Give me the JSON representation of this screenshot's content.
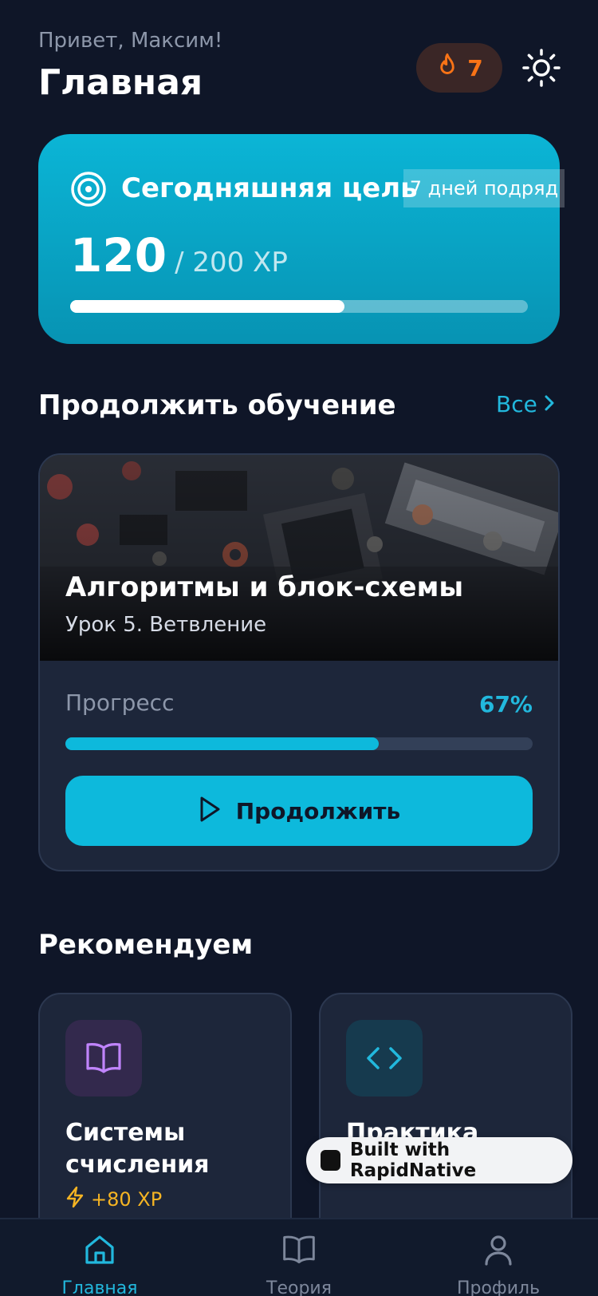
{
  "header": {
    "greeting": "Привет, Максим!",
    "title": "Главная",
    "streak_count": "7"
  },
  "goal": {
    "title": "Сегодняшняя цель",
    "badge": "7 дней подряд",
    "xp_current": "120",
    "xp_total": "/ 200 XP",
    "progress": 0.6
  },
  "continue_section": {
    "title": "Продолжить обучение",
    "all_link": "Все",
    "course": {
      "name": "Алгоритмы и блок-схемы",
      "lesson": "Урок 5. Ветвление",
      "progress_label": "Прогресс",
      "progress_pct": "67%",
      "progress": 0.67,
      "button": "Продолжить"
    }
  },
  "recommend": {
    "title": "Рекомендуем",
    "cards": [
      {
        "title": "Системы счисления",
        "xp": "+80 XP",
        "icon": "book-icon",
        "accent": "#c084fc"
      },
      {
        "title": "Практика Python",
        "icon": "code-icon",
        "accent": "#22b8dd"
      }
    ]
  },
  "badge": {
    "label": "Built with RapidNative"
  },
  "tabs": [
    {
      "label": "Главная",
      "icon": "home-icon",
      "active": true
    },
    {
      "label": "Теория",
      "icon": "book-icon",
      "active": false
    },
    {
      "label": "Профиль",
      "icon": "user-icon",
      "active": false
    }
  ],
  "colors": {
    "accent": "#0db9dc",
    "background": "#0f1628",
    "card": "#1d263a",
    "streak": "#f97316",
    "xp": "#f5b423"
  }
}
